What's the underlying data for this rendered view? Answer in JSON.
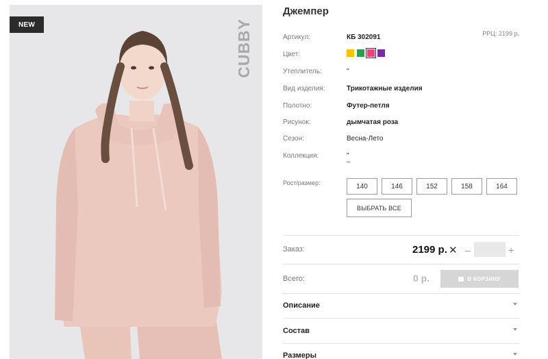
{
  "photo": {
    "badge": "NEW",
    "brand": "CUBBY"
  },
  "product": {
    "title": "Джемпер",
    "rrp": "РРЦ: 2199 р."
  },
  "attributes": [
    {
      "label": "Артикул:",
      "value": "КБ 302091"
    },
    {
      "label": "Цвет:",
      "value": ""
    },
    {
      "label": "Утеплитель:",
      "value": "\""
    },
    {
      "label": "Вид изделия:",
      "value": "Трикотажные изделия"
    },
    {
      "label": "Полотно:",
      "value": "Футер-петля"
    },
    {
      "label": "Рисунок:",
      "value": "дымчатая роза"
    },
    {
      "label": "Сезон:",
      "value": "Весна-Лето"
    },
    {
      "label": "Коллекция:",
      "value": "\""
    }
  ],
  "collection_extra": "–",
  "colors": [
    "#f5c400",
    "#2e9a55",
    "#e8457c",
    "#7a2aa8"
  ],
  "selected_color_index": 2,
  "size_label": "Рост/размер:",
  "sizes": [
    "140",
    "146",
    "152",
    "158",
    "164"
  ],
  "select_all": "ВЫБРАТЬ ВСЕ",
  "order": {
    "label": "Заказ:",
    "price": "2199 р.",
    "times": "✕",
    "minus": "–",
    "plus": "+",
    "quantity": ""
  },
  "total": {
    "label": "Всего:",
    "value": "0 р.",
    "cart_button": "В КОРЗИНУ"
  },
  "accordion": [
    "Описание",
    "Состав",
    "Размеры"
  ]
}
